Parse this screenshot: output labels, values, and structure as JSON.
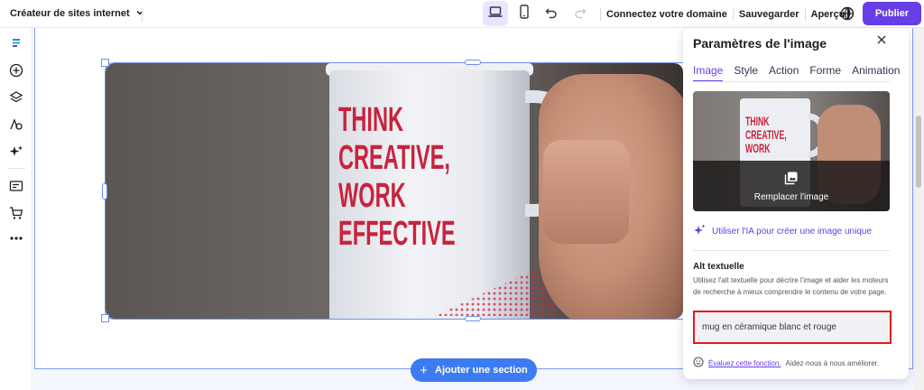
{
  "header": {
    "site_switch_label": "Créateur de sites internet",
    "connect_domain": "Connectez votre domaine",
    "save": "Sauvegarder",
    "preview": "Aperçu",
    "publish": "Publier"
  },
  "canvas": {
    "add_section": "Ajouter une section",
    "mug_text": [
      "THINK",
      "CREATIVE,",
      "WORK",
      "EFFECTIVE"
    ]
  },
  "panel": {
    "title": "Paramètres de l'image",
    "tabs": [
      "Image",
      "Style",
      "Action",
      "Forme",
      "Animation"
    ],
    "active_tab": "Image",
    "replace_image": "Remplacer l'image",
    "ai_link": "Utiliser l'IA pour créer une image unique",
    "alt_title": "Alt textuelle",
    "alt_desc": "Utilisez l'alt textuelle pour décrire l'image et aider les moteurs de recherche à mieux comprendre le contenu de votre page.",
    "alt_value": "mug en céramique blanc et rouge",
    "feedback_link": "Évaluez cette fonction.",
    "feedback_text": "Aidez-nous à nous améliorer."
  },
  "colors": {
    "accent": "#673de6",
    "add_section": "#3d7bf0",
    "highlight": "#e8151b"
  }
}
